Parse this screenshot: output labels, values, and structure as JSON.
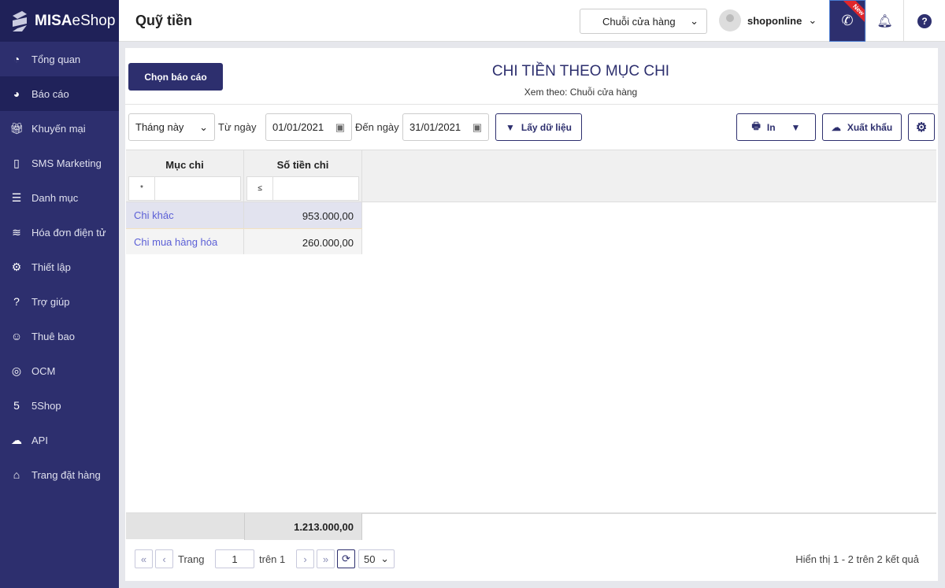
{
  "brand": {
    "logo_bold": "MISA",
    "logo_light": "eShop"
  },
  "sidebar": {
    "items": [
      {
        "label": "Tổng quan",
        "icon": "dashboard-icon"
      },
      {
        "label": "Báo cáo",
        "icon": "pie-chart-icon"
      },
      {
        "label": "Khuyến mại",
        "icon": "gift-icon"
      },
      {
        "label": "SMS Marketing",
        "icon": "mobile-icon"
      },
      {
        "label": "Danh mục",
        "icon": "list-icon"
      },
      {
        "label": "Hóa đơn điện tử",
        "icon": "invoice-icon"
      },
      {
        "label": "Thiết lập",
        "icon": "gear-icon"
      },
      {
        "label": "Trợ giúp",
        "icon": "help-icon"
      },
      {
        "label": "Thuê bao",
        "icon": "user-icon"
      },
      {
        "label": "OCM",
        "icon": "ocm-icon"
      },
      {
        "label": "5Shop",
        "icon": "5shop-icon"
      },
      {
        "label": "API",
        "icon": "cloud-upload-icon"
      },
      {
        "label": "Trang đặt hàng",
        "icon": "basket-icon"
      }
    ]
  },
  "header": {
    "title": "Quỹ tiền",
    "store": "Chuỗi cửa hàng",
    "user": "shoponline",
    "badge": "New"
  },
  "report": {
    "choose_label": "Chọn báo cáo",
    "title": "CHI TIỀN THEO MỤC CHI",
    "subtitle": "Xem theo: Chuỗi cửa hàng"
  },
  "filters": {
    "period": "Tháng này",
    "from_label": "Từ ngày",
    "from": "01/01/2021",
    "to_label": "Đến ngày",
    "to": "31/01/2021",
    "fetch_label": "Lấy dữ liệu",
    "print_label": "In",
    "export_label": "Xuất khẩu"
  },
  "table": {
    "columns": [
      "Mục chi",
      "Số tiền chi"
    ],
    "filter_ops": [
      "*",
      "≤"
    ],
    "rows": [
      {
        "category": "Chi khác",
        "amount": "953.000,00"
      },
      {
        "category": "Chi mua hàng hóa",
        "amount": "260.000,00"
      }
    ],
    "total": "1.213.000,00"
  },
  "pagination": {
    "page_label": "Trang",
    "page": "1",
    "of_label": "trên 1",
    "page_size": "50",
    "summary": "Hiển thị 1 - 2 trên 2 kết quả"
  }
}
